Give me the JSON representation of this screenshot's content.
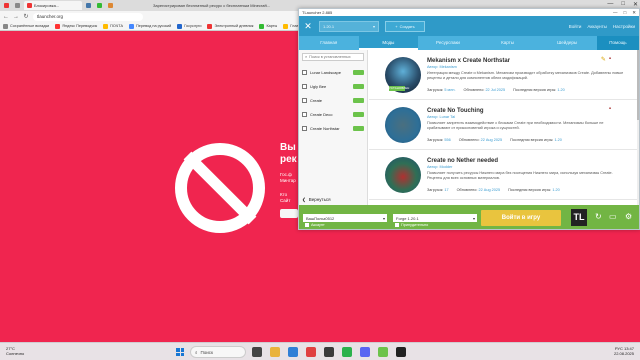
{
  "browser": {
    "active_tab_title": "Блокировка...",
    "window_title": "Зарегистрирован бесплатный ресурс с бесплатным Minecraft...",
    "url": "tlauncher.org",
    "window_buttons": [
      "—",
      "□",
      "✕"
    ],
    "bookmarks": [
      "Сохранённые вкладки",
      "Яндекс Переводчик",
      "ПОЧТА",
      "Перевод на русский",
      "Госуслуги",
      "Электронный дневник",
      "Карты",
      "Главная",
      "YouTube",
      "Музыка",
      "Новости",
      "Погода"
    ]
  },
  "blocked_page": {
    "heading": "Вы\nрек",
    "text": "Гос.ф Минтар",
    "text2": "Кто Сайт"
  },
  "launcher": {
    "title": "TLauncher 2.885",
    "version_select": "1.20.1",
    "action_button": "Создать",
    "links": [
      "Войти",
      "Аккаунты",
      "Настройки"
    ],
    "tabs": [
      "Главная",
      "Моды",
      "Ресурспаки",
      "Карты",
      "Шейдеры",
      "Помощь"
    ],
    "active_tab": "Моды",
    "sidebar": {
      "search_placeholder": "Поиск в установленных",
      "mods": [
        "Lunar Landscape",
        "Ugly Bee",
        "Create",
        "Create Deco",
        "Create Northstar"
      ],
      "back_label": "Вернуться"
    },
    "mods": [
      {
        "title": "Mekanism x Create Northstar",
        "author": "Автор: Mekanism",
        "description": "Интеграция между Create и Mekanism. Механизм производит обработку механизмов Create. Добавлены новые рецепты и детали для компонентов обеих модификаций.",
        "downloads": "5 млн.",
        "updated": "22 Jul 2025",
        "version": "1.20",
        "flag": "УСТАНОВЛЕН"
      },
      {
        "title": "Create No Touching",
        "author": "Автор: Lunar Tal",
        "description": "Позволяет запретить взаимодействие с блоками Create при необходимости. Механизмы больше не срабатывают от прикосновений игрока и сущностей.",
        "downloads": "556",
        "updated": "22 Aug 2025",
        "version": "1.20",
        "flag": ""
      },
      {
        "title": "Create no Nether needed",
        "author": "Автор: Modder",
        "description": "Позволяет получить ресурсы Нижнего мира без посещения Нижнего мира, используя механизмы Create. Рецепты для всех основных материалов.",
        "downloads": "17",
        "updated": "22 Aug 2025",
        "version": "1.20",
        "flag": ""
      }
    ],
    "meta_labels": {
      "downloads": "Загрузок:",
      "updated": "Обновлено:",
      "version": "Последняя версия игры:"
    },
    "bottom": {
      "account_select": "ВашПольз0512",
      "version_select": "Forge 1.20.1",
      "account_sub": "Аккаунт",
      "version_sub": "Принудительно",
      "play_button": "Войти в игру",
      "logo": "TL"
    }
  },
  "taskbar": {
    "weather": "27°C",
    "weather_sub": "Солнечно",
    "search_placeholder": "Поиск",
    "time": "13:47",
    "date": "22.08.2025",
    "lang": "РУС"
  },
  "colors": {
    "page_bg": "#f0254f",
    "launcher_blue": "#2f9ac8",
    "launcher_green": "#72b544",
    "play_yellow": "#e9c43e"
  }
}
